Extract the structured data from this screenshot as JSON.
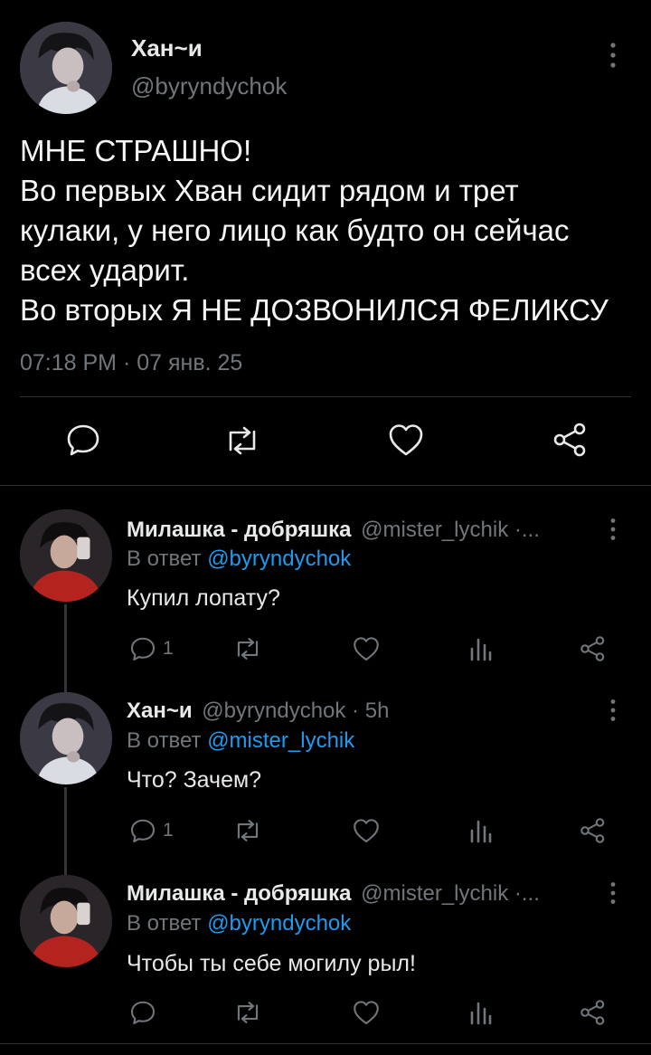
{
  "main_tweet": {
    "author_name": "Хан~и",
    "author_handle": "@byryndychok",
    "text_lines": [
      "МНЕ СТРАШНО!",
      "Во первых Хван сидит рядом и трет",
      "кулаки, у него лицо как будто он сейчас",
      "всех ударит.",
      "Во вторых Я НЕ ДОЗВОНИЛСЯ ФЕЛИКСУ"
    ],
    "timestamp": "07:18 PM · 07 янв. 25"
  },
  "replies": [
    {
      "author_name": "Милашка - добряшка",
      "meta": "@mister_lychik ·...",
      "reply_prefix": "В ответ",
      "reply_to": "@byryndychok",
      "text": "Купил лопату?",
      "reply_count": "1"
    },
    {
      "author_name": "Хан~и",
      "meta": "@byryndychok · 5h",
      "reply_prefix": "В ответ",
      "reply_to": "@mister_lychik",
      "text": "Что? Зачем?",
      "reply_count": "1"
    },
    {
      "author_name": "Милашка - добряшка",
      "meta": "@mister_lychik ·...",
      "reply_prefix": "В ответ",
      "reply_to": "@byryndychok",
      "text": "Чтобы ты себе могилу рыл!",
      "reply_count": ""
    }
  ],
  "colors": {
    "background": "#000000",
    "text": "#e7e9ea",
    "muted": "#71767b",
    "link": "#1d9bf0",
    "divider": "#2f3336"
  },
  "icons": [
    "reply-icon",
    "retweet-icon",
    "like-icon",
    "share-icon",
    "analytics-icon",
    "more-icon"
  ]
}
